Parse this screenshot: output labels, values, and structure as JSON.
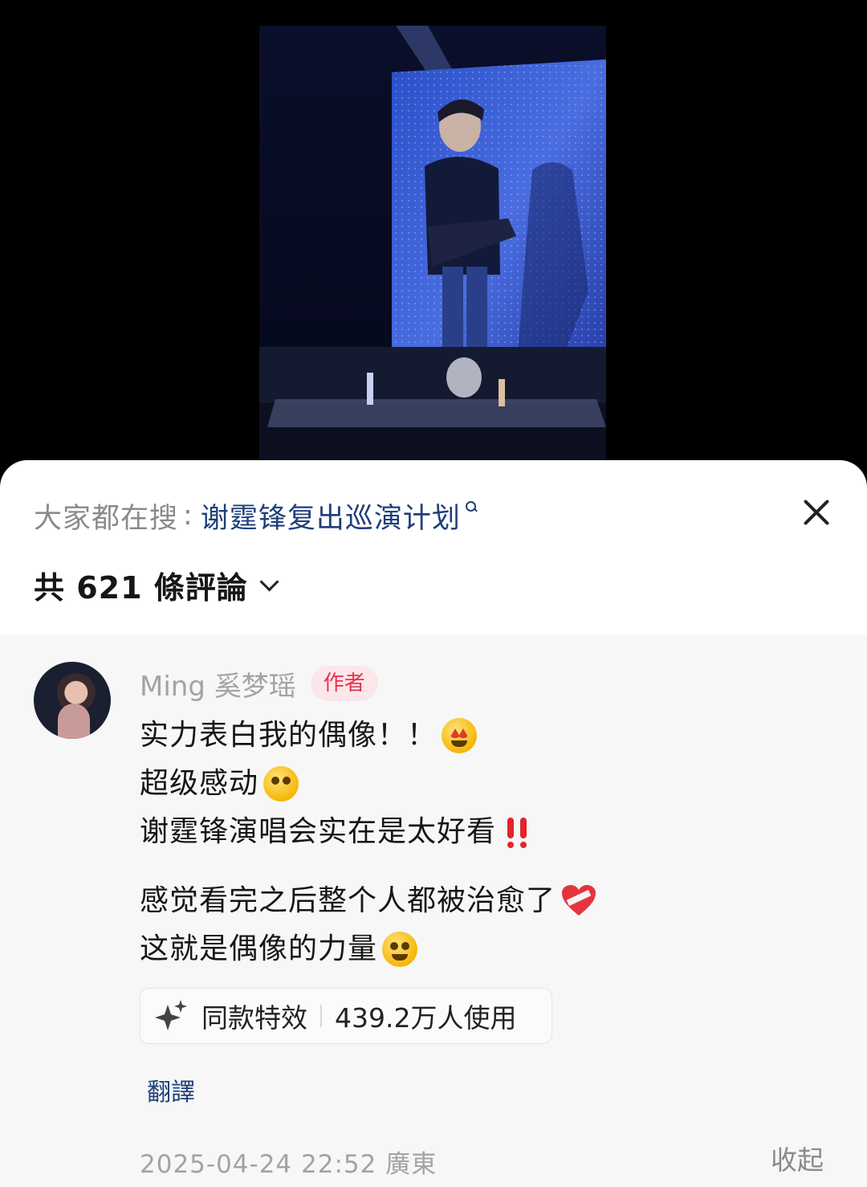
{
  "search_bar": {
    "prefix": "大家都在搜",
    "colon": ":",
    "query": "谢霆锋复出巡演计划"
  },
  "header": {
    "comment_count": "共 621 條評論"
  },
  "comment": {
    "author_name": "Ming 奚梦瑶",
    "author_badge": "作者",
    "lines": [
      "实力表白我的偶像！！",
      "超级感动",
      "谢霆锋演唱会实在是太好看",
      "感觉看完之后整个人都被治愈了",
      "这就是偶像的力量"
    ],
    "emojis": [
      "star-struck",
      "pleading-face",
      "double-exclamation",
      "mending-heart",
      "hugging-face"
    ],
    "effect_label": "同款特效",
    "effect_users": "439.2万人使用",
    "translate_label": "翻譯",
    "timestamp_location": "2025-04-24 22:52 廣東",
    "collapse_label": "收起"
  },
  "icons": {
    "close": "close-icon",
    "chevron": "chevron-down-icon",
    "search": "search-icon",
    "sparkle": "sparkle-icon"
  },
  "colors": {
    "link": "#1f3f7a",
    "badge_text": "#e8334f",
    "badge_bg": "#fbe6ea",
    "muted": "#a3a3a3"
  }
}
